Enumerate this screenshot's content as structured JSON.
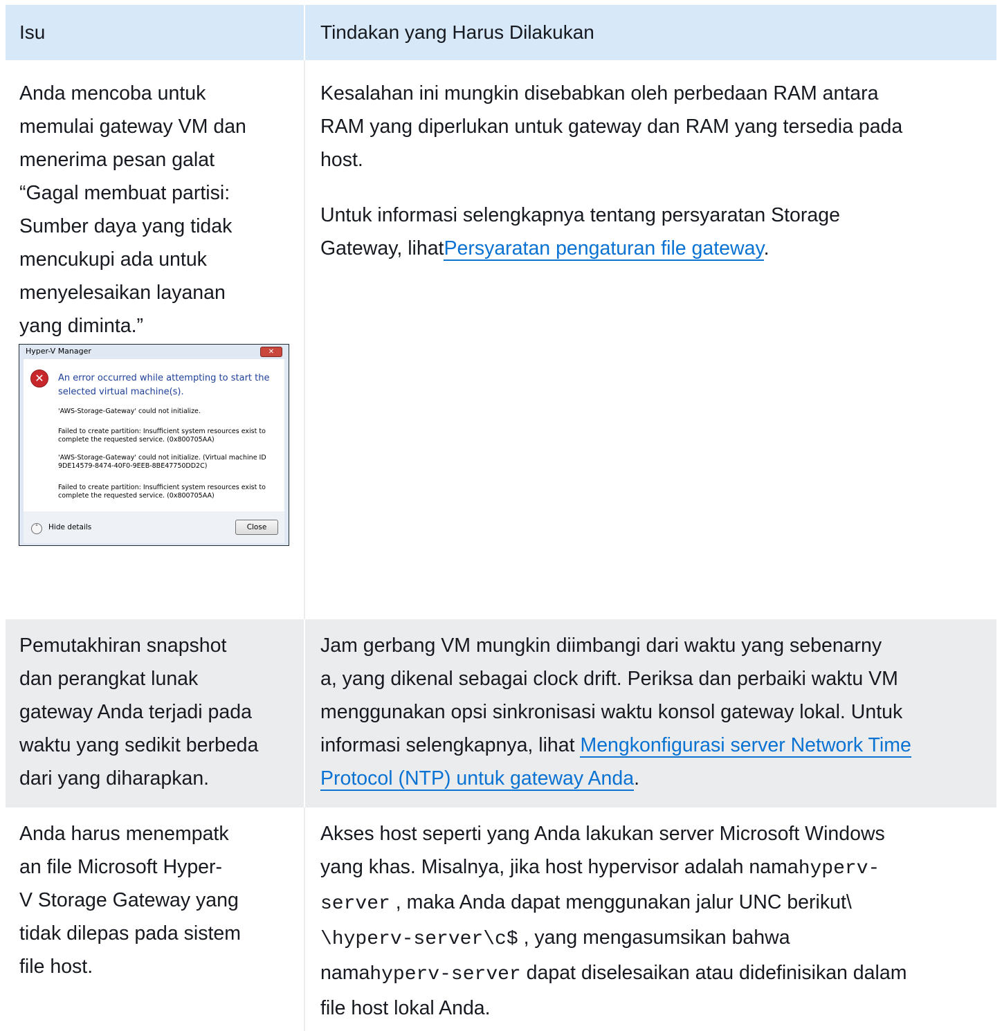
{
  "table": {
    "headers": [
      "Isu",
      "Tindakan yang Harus Dilakukan"
    ],
    "rows": [
      {
        "issue": [
          "Anda mencoba untuk",
          "memulai gateway VM dan",
          "menerima pesan galat",
          "“Gagal membuat partisi:",
          "Sumber daya yang tidak",
          "mencukupi ada untuk",
          "menyelesaikan layanan",
          "yang diminta.”"
        ],
        "action_p1": [
          "Kesalahan ini mungkin disebabkan oleh perbedaan RAM antara",
          "RAM yang diperlukan untuk gateway dan RAM yang tersedia pada",
          "host."
        ],
        "action_p2_line1": "Untuk informasi selengkapnya tentang persyaratan Storage",
        "action_p2_prefix": "Gateway, lihat",
        "action_p2_link": "Persyaratan pengaturan file gateway",
        "action_p2_suffix": "."
      },
      {
        "issue": [
          "Pemutakhiran snapshot",
          "dan perangkat lunak",
          "gateway Anda terjadi pada",
          "waktu yang sedikit berbeda",
          "dari yang diharapkan."
        ],
        "action_lines": [
          "Jam gerbang VM mungkin diimbangi dari waktu yang sebenarny",
          "a, yang dikenal sebagai clock drift. Periksa dan perbaiki waktu VM",
          "menggunakan opsi sinkronisasi waktu konsol gateway lokal. Untuk"
        ],
        "action_line4_prefix": "informasi selengkapnya, lihat ",
        "action_link_part1": "Mengkonfigurasi server Network Time",
        "action_link_part2": "Protocol (NTP) untuk gateway Anda",
        "action_suffix": "."
      },
      {
        "issue": [
          "Anda harus menempatk",
          "an file Microsoft Hyper-",
          "V Storage Gateway yang",
          "tidak dilepas pada sistem",
          "file host."
        ],
        "action_l1": "Akses host seperti yang Anda lakukan server Microsoft Windows",
        "action_l2_prefix": "yang khas. Misalnya, jika host hypervisor adalah nama",
        "action_l2_code": "hyperv-",
        "action_l3_code": "server",
        "action_l3_text": " , maka Anda dapat menggunakan jalur UNC berikut\\",
        "action_l4_code": "\\hyperv-server\\c$",
        "action_l4_text": " , yang mengasumsikan bahwa",
        "action_l5_prefix": "nama",
        "action_l5_code": "hyperv-server",
        "action_l5_text": " dapat diselesaikan atau didefinisikan dalam",
        "action_l6": "file host lokal Anda."
      }
    ]
  },
  "dialog": {
    "title": "Hyper-V Manager",
    "main_message": "An error occurred while attempting to start the selected virtual machine(s).",
    "details": [
      "'AWS-Storage-Gateway' could not initialize.",
      "Failed to create partition: Insufficient system resources exist to complete the requested service. (0x800705AA)",
      "'AWS-Storage-Gateway' could not initialize. (Virtual machine ID 9DE14579-8474-40F0-9EEB-8BE47750DD2C)",
      "Failed to create partition: Insufficient system resources exist to complete the requested service. (0x800705AA)"
    ],
    "hide_details": "Hide details",
    "close_button": "Close",
    "close_x": "✕",
    "error_glyph": "✕",
    "hide_glyph": "˄"
  }
}
